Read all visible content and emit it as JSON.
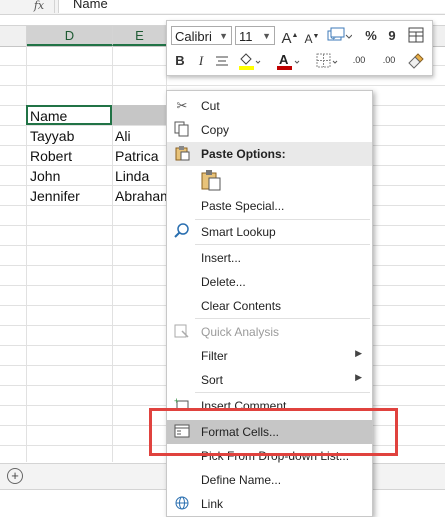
{
  "formula_bar": {
    "fx": "fx",
    "value": "Name"
  },
  "columns": [
    {
      "label": "D"
    },
    {
      "label": "E"
    }
  ],
  "cells": {
    "d1": "Name",
    "d2": "Tayyab",
    "e2": "Ali",
    "d3": "Robert",
    "e3": "Patrica",
    "d4": "John",
    "e4": "Linda",
    "d5": "Jennifer",
    "e5": "Abraham"
  },
  "mini_toolbar": {
    "font": "Calibri",
    "size": "11",
    "grow": "A",
    "shrink": "A",
    "currency": "$",
    "percent": "%",
    "comma": "9",
    "bold": "B",
    "italic": "I",
    "font_color": "A",
    "inc_decimal": ".00",
    "dec_decimal": ".00"
  },
  "context_menu": {
    "cut": "Cut",
    "copy": "Copy",
    "paste_options": "Paste Options:",
    "paste_special": "Paste Special...",
    "smart_lookup": "Smart Lookup",
    "insert": "Insert...",
    "delete": "Delete...",
    "clear_contents": "Clear Contents",
    "quick_analysis": "Quick Analysis",
    "filter": "Filter",
    "sort": "Sort",
    "insert_comment": "Insert Comment",
    "format_cells": "Format Cells...",
    "pick_from_list": "Pick From Drop-down List...",
    "define_name": "Define Name...",
    "link": "Link"
  },
  "colors": {
    "accent": "#217346",
    "annotation": "#e0423e",
    "highlight_yellow": "#ffff00",
    "font_color_red": "#c00000"
  }
}
